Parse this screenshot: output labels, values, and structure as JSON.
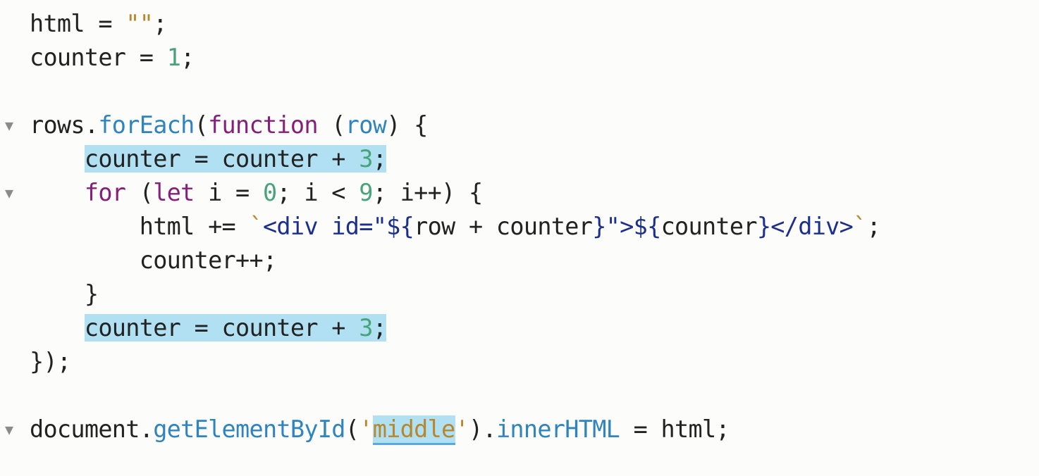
{
  "editor": {
    "lines": [
      {
        "fold": false,
        "tokens": [
          {
            "t": "plain",
            "v": "html = "
          },
          {
            "t": "str",
            "v": "\"\""
          },
          {
            "t": "plain",
            "v": ";"
          }
        ]
      },
      {
        "fold": false,
        "tokens": [
          {
            "t": "plain",
            "v": "counter = "
          },
          {
            "t": "num",
            "v": "1"
          },
          {
            "t": "plain",
            "v": ";"
          }
        ]
      },
      {
        "fold": false,
        "tokens": []
      },
      {
        "fold": true,
        "tokens": [
          {
            "t": "plain",
            "v": "rows."
          },
          {
            "t": "fn",
            "v": "forEach"
          },
          {
            "t": "plain",
            "v": "("
          },
          {
            "t": "kw",
            "v": "function"
          },
          {
            "t": "plain",
            "v": " ("
          },
          {
            "t": "param",
            "v": "row"
          },
          {
            "t": "plain",
            "v": ") {"
          }
        ]
      },
      {
        "fold": false,
        "indent": "    ",
        "highlight": true,
        "tokens": [
          {
            "t": "plain",
            "v": "counter = counter + "
          },
          {
            "t": "num",
            "v": "3"
          },
          {
            "t": "plain",
            "v": ";"
          }
        ]
      },
      {
        "fold": true,
        "indent": "    ",
        "tokens": [
          {
            "t": "kw",
            "v": "for"
          },
          {
            "t": "plain",
            "v": " ("
          },
          {
            "t": "kw",
            "v": "let"
          },
          {
            "t": "plain",
            "v": " i = "
          },
          {
            "t": "num",
            "v": "0"
          },
          {
            "t": "plain",
            "v": "; i < "
          },
          {
            "t": "num",
            "v": "9"
          },
          {
            "t": "plain",
            "v": "; i++) {"
          }
        ]
      },
      {
        "fold": false,
        "indent": "        ",
        "tokens": [
          {
            "t": "plain",
            "v": "html += "
          },
          {
            "t": "str",
            "v": "`"
          },
          {
            "t": "tpl",
            "v": "<div id=\"${"
          },
          {
            "t": "plain",
            "v": "row + counter"
          },
          {
            "t": "tpl",
            "v": "}\">${"
          },
          {
            "t": "plain",
            "v": "counter"
          },
          {
            "t": "tpl",
            "v": "}</div>"
          },
          {
            "t": "str",
            "v": "`"
          },
          {
            "t": "plain",
            "v": ";"
          }
        ]
      },
      {
        "fold": false,
        "indent": "        ",
        "tokens": [
          {
            "t": "plain",
            "v": "counter++;"
          }
        ]
      },
      {
        "fold": false,
        "indent": "    ",
        "tokens": [
          {
            "t": "plain",
            "v": "}"
          }
        ]
      },
      {
        "fold": false,
        "indent": "    ",
        "highlight": true,
        "tokens": [
          {
            "t": "plain",
            "v": "counter = counter + "
          },
          {
            "t": "num",
            "v": "3"
          },
          {
            "t": "plain",
            "v": ";"
          }
        ]
      },
      {
        "fold": false,
        "tokens": [
          {
            "t": "plain",
            "v": "});"
          }
        ]
      },
      {
        "fold": false,
        "tokens": []
      },
      {
        "fold": true,
        "tokens": [
          {
            "t": "plain",
            "v": "document."
          },
          {
            "t": "fn",
            "v": "getElementById"
          },
          {
            "t": "plain",
            "v": "("
          },
          {
            "t": "str",
            "v": "'"
          },
          {
            "t": "str",
            "v": "middle",
            "sel": true
          },
          {
            "t": "str",
            "v": "'"
          },
          {
            "t": "plain",
            "v": ")."
          },
          {
            "t": "fn",
            "v": "innerHTML"
          },
          {
            "t": "plain",
            "v": " = html;"
          }
        ]
      }
    ],
    "fold_glyph": "▼",
    "fold_icon": "fold-arrow-icon",
    "colors": {
      "plain": "#222222",
      "string": "#b7872d",
      "number": "#47a37a",
      "function": "#2f84be",
      "keyword": "#84207a",
      "template": "#1b2f8c",
      "highlight": "#b0e0f2",
      "selection_underline": "#5aa8e0",
      "background": "#fcfcfb"
    }
  }
}
